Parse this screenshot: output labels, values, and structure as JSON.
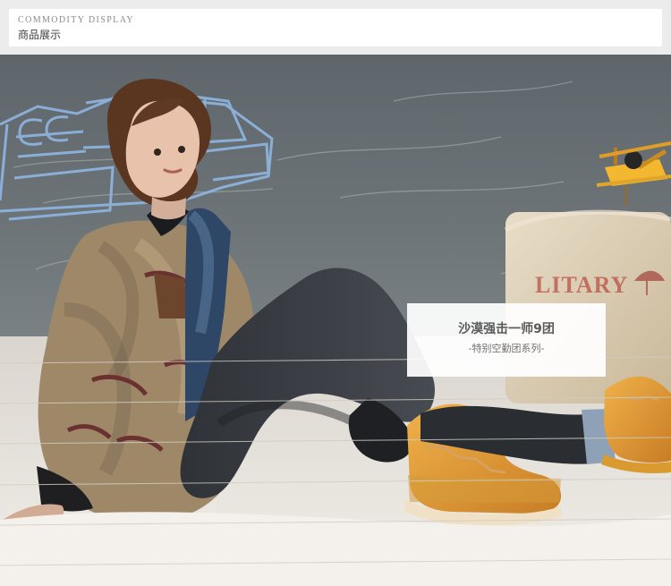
{
  "header": {
    "english_title": "COMMODITY DISPLAY",
    "chinese_title": "商品展示"
  },
  "hero": {
    "photo": "boy in camouflage jacket with tan boots",
    "caption": {
      "title": "沙漠强击一师9团",
      "subtitle": "-特别空勤团系列-"
    },
    "pillow_text": "LITARY"
  }
}
